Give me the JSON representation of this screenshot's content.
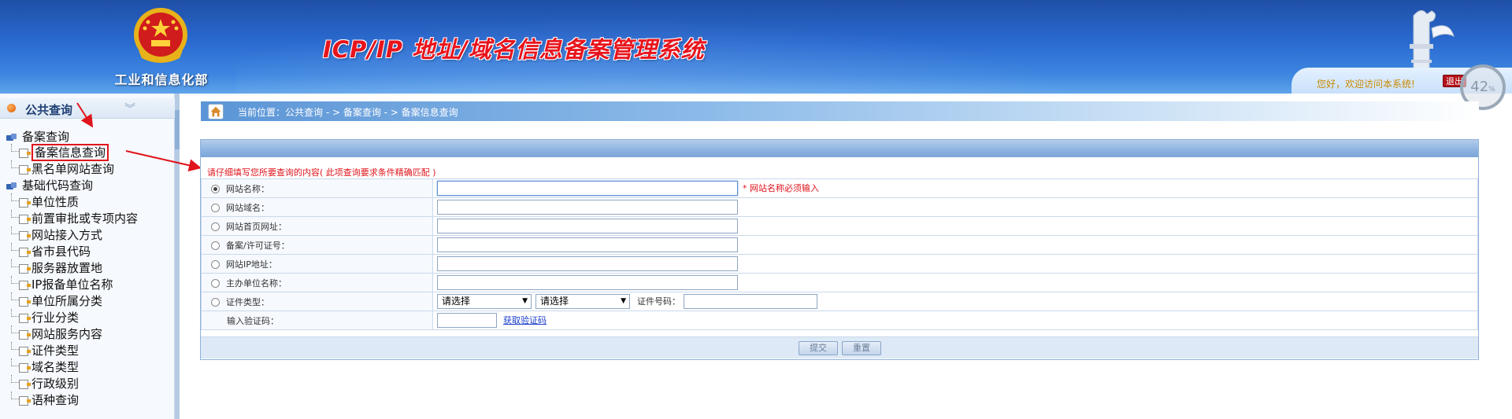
{
  "header": {
    "ministry_name": "工业和信息化部",
    "system_title": "ICP/IP 地址/域名信息备案管理系统",
    "welcome_text": "您好，欢迎访问本系统!",
    "logout_label": "退出",
    "zoom_value": "42",
    "zoom_unit": "%"
  },
  "sidebar": {
    "title": "公共查询",
    "groups": [
      {
        "label": "备案查询",
        "items": [
          {
            "label": "备案信息查询",
            "active": true
          },
          {
            "label": "黑名单网站查询",
            "active": false
          }
        ]
      },
      {
        "label": "基础代码查询",
        "items": [
          {
            "label": "单位性质"
          },
          {
            "label": "前置审批或专项内容"
          },
          {
            "label": "网站接入方式"
          },
          {
            "label": "省市县代码"
          },
          {
            "label": "服务器放置地"
          },
          {
            "label": "IP报备单位名称"
          },
          {
            "label": "单位所属分类"
          },
          {
            "label": "行业分类"
          },
          {
            "label": "网站服务内容"
          },
          {
            "label": "证件类型"
          },
          {
            "label": "域名类型"
          },
          {
            "label": "行政级别"
          },
          {
            "label": "语种查询"
          }
        ]
      }
    ]
  },
  "breadcrumb": {
    "text": "当前位置：公共查询  - > 备案查询  - > 备案信息查询"
  },
  "form": {
    "notice": "请仔细填写您所要查询的内容( 此项查询要求条件精确匹配 )",
    "fields": [
      {
        "label": "网站名称：",
        "checked": true,
        "hint": "* 网站名称必须输入"
      },
      {
        "label": "网站域名：",
        "checked": false,
        "hint": ""
      },
      {
        "label": "网站首页网址：",
        "checked": false,
        "hint": ""
      },
      {
        "label": "备案/许可证号：",
        "checked": false,
        "hint": ""
      },
      {
        "label": "网站IP地址：",
        "checked": false,
        "hint": ""
      },
      {
        "label": "主办单位名称：",
        "checked": false,
        "hint": ""
      }
    ],
    "cert_type_label": "证件类型：",
    "cert_select_1": "请选择",
    "cert_select_2": "请选择",
    "cert_no_label": "证件号码：",
    "captcha_label": "输入验证码：",
    "captcha_link": "获取验证码",
    "submit_label": "提交",
    "reset_label": "重置"
  },
  "colors": {
    "accent_red": "#e0141c",
    "header_blue": "#2a6ad0",
    "link_blue": "#1a3fcc"
  }
}
